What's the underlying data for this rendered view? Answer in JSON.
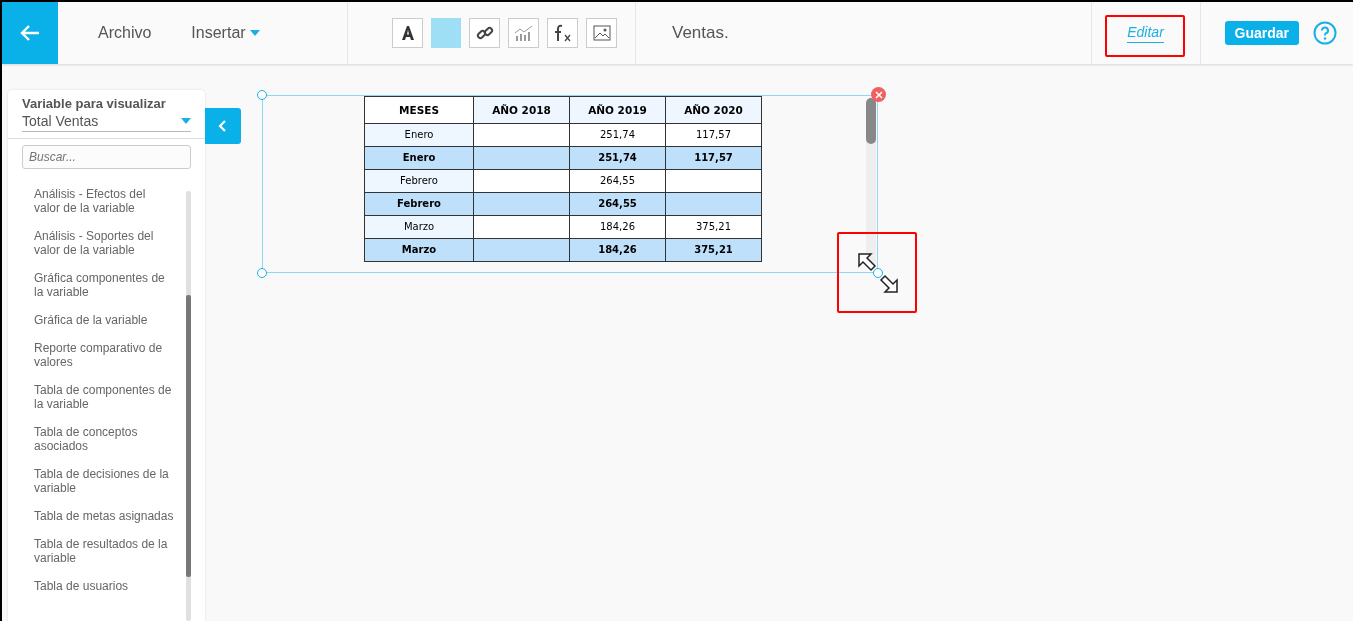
{
  "toolbar": {
    "menus": [
      {
        "label": "Archivo",
        "dropdown": false
      },
      {
        "label": "Insertar",
        "dropdown": true
      }
    ],
    "title": "Ventas.",
    "edit_link": "Editar",
    "save_button": "Guardar"
  },
  "sidebar": {
    "heading": "Variable para visualizar",
    "variable": "Total Ventas",
    "search": {
      "placeholder": "Buscar..."
    },
    "items": [
      "Análisis - Efectos del valor de la variable",
      "Análisis - Soportes del valor de la variable",
      "Gráfica componentes de la variable",
      "Gráfica de la variable",
      "Reporte comparativo de valores",
      "Tabla de componentes de la variable",
      "Tabla de conceptos asociados",
      "Tabla de decisiones de la variable",
      "Tabla de metas asignadas",
      "Tabla de resultados de la variable",
      "Tabla de usuarios"
    ]
  },
  "table": {
    "columns": [
      "MESES",
      "AÑO 2018",
      "AÑO 2019",
      "AÑO 2020"
    ],
    "rows": [
      {
        "kind": "detail",
        "cells": [
          "Enero",
          "",
          "251,74",
          "117,57"
        ]
      },
      {
        "kind": "total",
        "cells": [
          "Enero",
          "",
          "251,74",
          "117,57"
        ]
      },
      {
        "kind": "detail",
        "cells": [
          "Febrero",
          "",
          "264,55",
          ""
        ]
      },
      {
        "kind": "total",
        "cells": [
          "Febrero",
          "",
          "264,55",
          ""
        ]
      },
      {
        "kind": "detail",
        "cells": [
          "Marzo",
          "",
          "184,26",
          "375,21"
        ]
      },
      {
        "kind": "total",
        "cells": [
          "Marzo",
          "",
          "184,26",
          "375,21"
        ]
      }
    ]
  }
}
